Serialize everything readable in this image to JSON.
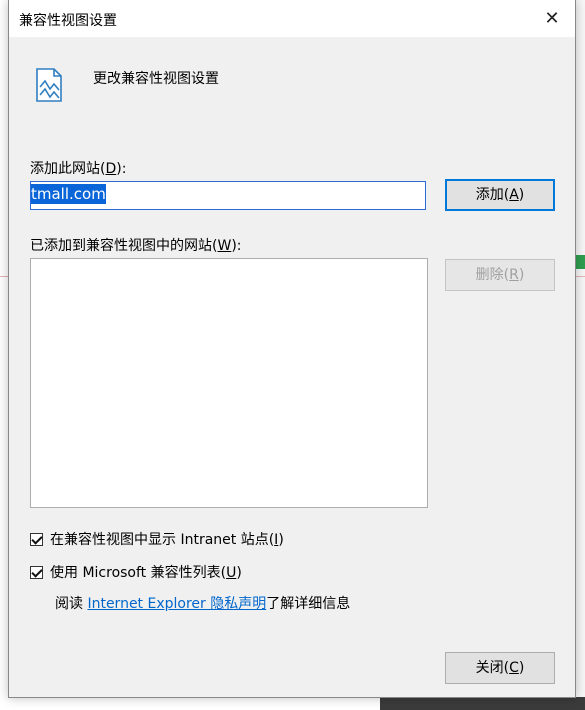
{
  "dialog": {
    "title": "兼容性视图设置",
    "close_glyph": "✕",
    "header_text": "更改兼容性视图设置",
    "add_site_label_prefix": "添加此网站(",
    "add_site_label_key": "D",
    "add_site_label_suffix": "):",
    "url_value": "tmall.com",
    "add_button_prefix": "添加(",
    "add_button_key": "A",
    "add_button_suffix": ")",
    "list_label_prefix": "已添加到兼容性视图中的网站(",
    "list_label_key": "W",
    "list_label_suffix": "):",
    "remove_button_prefix": "删除(",
    "remove_button_key": "R",
    "remove_button_suffix": ")",
    "checkbox1_prefix": "在兼容性视图中显示 Intranet 站点(",
    "checkbox1_key": "I",
    "checkbox1_suffix": ")",
    "checkbox1_checked": true,
    "checkbox2_prefix": "使用 Microsoft 兼容性列表(",
    "checkbox2_key": "U",
    "checkbox2_suffix": ")",
    "checkbox2_checked": true,
    "info_prefix": "阅读 ",
    "info_link": "Internet Explorer 隐私声明",
    "info_suffix": "了解详细信息",
    "close_button_prefix": "关闭(",
    "close_button_key": "C",
    "close_button_suffix": ")"
  },
  "colors": {
    "accent": "#0078d7",
    "selection": "#0a66d8",
    "link": "#0066cc",
    "dialog_bg": "#f0f0f0"
  }
}
